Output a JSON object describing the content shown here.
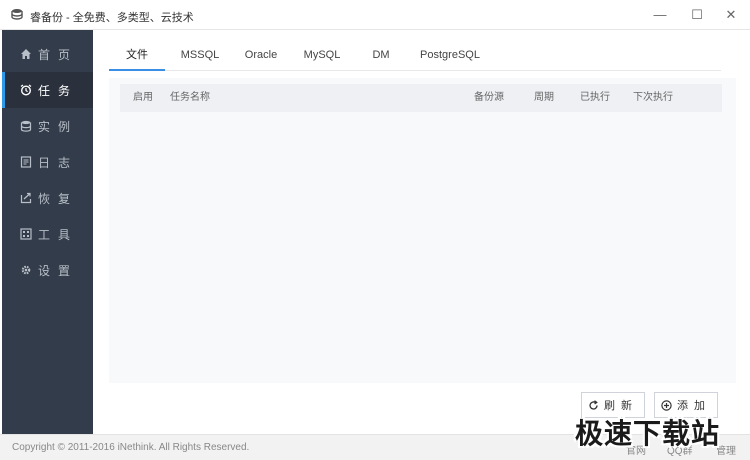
{
  "window": {
    "title": "睿备份 - 全免费、多类型、云技术",
    "controls": {
      "minimize": "—",
      "maximize": "☐",
      "close": "✕"
    }
  },
  "sidebar": {
    "items": [
      {
        "label": "首页",
        "icon": "home-icon"
      },
      {
        "label": "任务",
        "icon": "alarm-clock-icon",
        "active": true
      },
      {
        "label": "实例",
        "icon": "database-icon"
      },
      {
        "label": "日志",
        "icon": "log-icon"
      },
      {
        "label": "恢复",
        "icon": "restore-icon"
      },
      {
        "label": "工具",
        "icon": "tools-icon"
      },
      {
        "label": "设置",
        "icon": "gear-icon"
      }
    ]
  },
  "tabs": [
    {
      "label": "文件",
      "active": true
    },
    {
      "label": "MSSQL"
    },
    {
      "label": "Oracle"
    },
    {
      "label": "MySQL"
    },
    {
      "label": "DM"
    },
    {
      "label": "PostgreSQL"
    }
  ],
  "table": {
    "columns": [
      "启用",
      "任务名称",
      "备份源",
      "周期",
      "已执行",
      "下次执行"
    ],
    "rows": []
  },
  "actions": {
    "refresh_label": "刷新",
    "add_label": "添加"
  },
  "footer": {
    "copyright": "Copyright © 2011-2016 iNethink. All Rights Reserved.",
    "links": [
      "官网",
      "QQ群",
      "管理"
    ]
  },
  "watermark": "极速下载站",
  "colors": {
    "sidebar_bg": "#333c4a",
    "accent": "#3a8ee6"
  }
}
